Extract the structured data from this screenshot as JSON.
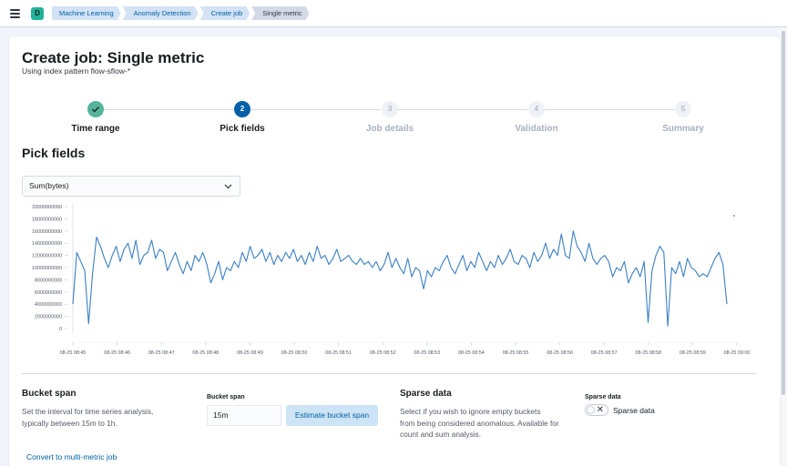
{
  "header": {
    "avatar_letter": "D",
    "breadcrumbs": [
      "Machine Learning",
      "Anomaly Detection",
      "Create job",
      "Single metric"
    ]
  },
  "page": {
    "title": "Create job: Single metric",
    "subtitle": "Using index pattern flow-sflow-*"
  },
  "steps": [
    {
      "number": "1",
      "label": "Time range",
      "state": "complete"
    },
    {
      "number": "2",
      "label": "Pick fields",
      "state": "current"
    },
    {
      "number": "3",
      "label": "Job details",
      "state": "incomplete"
    },
    {
      "number": "4",
      "label": "Validation",
      "state": "incomplete"
    },
    {
      "number": "5",
      "label": "Summary",
      "state": "incomplete"
    }
  ],
  "pick_fields": {
    "heading": "Pick fields",
    "aggregation_select": "Sum(bytes)"
  },
  "chart_data": {
    "type": "line",
    "y_ticks": [
      "20000000000",
      "18000000000",
      "16000000000",
      "14000000000",
      "12000000000",
      "10000000000",
      "8000000000",
      "6000000000",
      "4000000000",
      "2000000000",
      "0"
    ],
    "ylim": [
      0,
      20000000000
    ],
    "x_ticks": [
      "08-25 08:45",
      "08-25 08:46",
      "08-25 08:47",
      "08-25 08:48",
      "08-25 08:49",
      "08-25 08:50",
      "08-25 08:51",
      "08-25 08:52",
      "08-25 08:53",
      "08-25 08:54",
      "08-25 08:55",
      "08-25 08:56",
      "08-25 08:57",
      "08-25 08:58",
      "08-25 08:59",
      "08-25 09:00"
    ],
    "line_color": "#3b7fc4",
    "series": [
      {
        "values": [
          4000000000,
          12500000000,
          11000000000,
          9500000000,
          800000000,
          9000000000,
          15000000000,
          13500000000,
          11500000000,
          10000000000,
          12000000000,
          13500000000,
          11000000000,
          13000000000,
          14000000000,
          11500000000,
          14500000000,
          10500000000,
          12000000000,
          12500000000,
          14500000000,
          11500000000,
          13000000000,
          12500000000,
          9500000000,
          11000000000,
          12500000000,
          10500000000,
          9000000000,
          11000000000,
          9500000000,
          12000000000,
          11000000000,
          12500000000,
          10500000000,
          7500000000,
          9000000000,
          11000000000,
          8000000000,
          10000000000,
          9500000000,
          11000000000,
          10000000000,
          12500000000,
          11000000000,
          13500000000,
          11500000000,
          12000000000,
          13000000000,
          11000000000,
          12500000000,
          10500000000,
          12000000000,
          11000000000,
          12500000000,
          11500000000,
          13000000000,
          11000000000,
          12000000000,
          10500000000,
          12500000000,
          11000000000,
          13500000000,
          11500000000,
          12000000000,
          10500000000,
          11500000000,
          13000000000,
          11000000000,
          11500000000,
          12000000000,
          11000000000,
          10500000000,
          11500000000,
          10500000000,
          11000000000,
          10000000000,
          11000000000,
          9500000000,
          10500000000,
          12500000000,
          10000000000,
          11500000000,
          10000000000,
          9000000000,
          11500000000,
          8500000000,
          10000000000,
          9500000000,
          6500000000,
          9500000000,
          8500000000,
          10000000000,
          9500000000,
          11000000000,
          12000000000,
          10000000000,
          9000000000,
          10500000000,
          12000000000,
          9500000000,
          11000000000,
          10000000000,
          12500000000,
          11000000000,
          9500000000,
          11000000000,
          10000000000,
          12000000000,
          10500000000,
          11500000000,
          13000000000,
          11000000000,
          10500000000,
          12000000000,
          11500000000,
          10000000000,
          12500000000,
          11000000000,
          12000000000,
          14000000000,
          11500000000,
          13000000000,
          12000000000,
          15500000000,
          12000000000,
          11500000000,
          16000000000,
          13500000000,
          12500000000,
          11000000000,
          14000000000,
          11500000000,
          10500000000,
          11500000000,
          12000000000,
          11000000000,
          8500000000,
          10000000000,
          9500000000,
          11000000000,
          7500000000,
          9000000000,
          10000000000,
          8500000000,
          11000000000,
          1000000000,
          9500000000,
          12000000000,
          13500000000,
          12500000000,
          400000000,
          10000000000,
          9000000000,
          11000000000,
          8500000000,
          11500000000,
          10000000000,
          9500000000,
          8500000000,
          9000000000,
          8500000000,
          10000000000,
          11500000000,
          12500000000,
          10500000000,
          4000000000
        ],
        "extra_point_at_end": 18500000000
      }
    ],
    "grid": false
  },
  "bucket_span": {
    "title": "Bucket span",
    "description_line1": "Set the interval for time series analysis,",
    "description_line2": "typically between 15m to 1h.",
    "field_label": "Bucket span",
    "value": "15m",
    "estimate_button": "Estimate bucket span"
  },
  "sparse_data": {
    "title": "Sparse data",
    "description_line1": "Select if you wish to ignore empty buckets",
    "description_line2": "from being considered anomalous. Available for",
    "description_line3": "count and sum analysis.",
    "field_label": "Sparse data",
    "toggle_label": "Sparse data",
    "toggle_on": false
  },
  "footer": {
    "convert_link": "Convert to multi-metric job"
  }
}
